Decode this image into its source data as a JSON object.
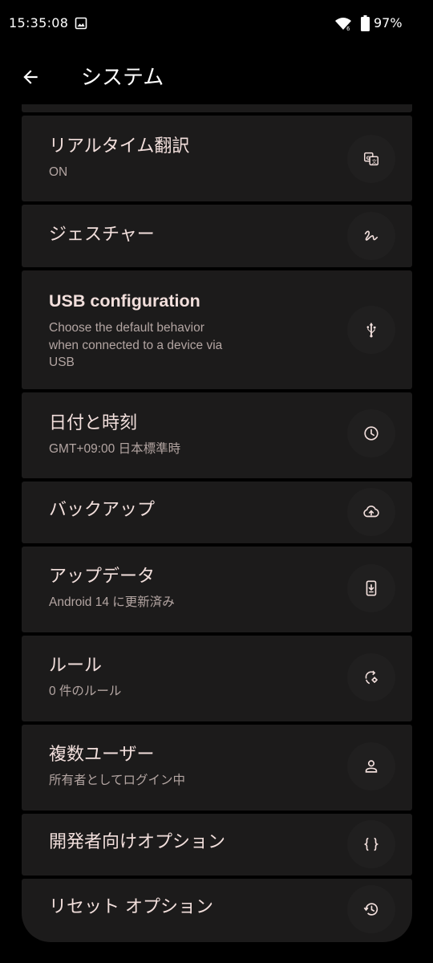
{
  "status_bar": {
    "time": "15:35:08",
    "battery_percent": "97%",
    "icons": [
      "image-icon",
      "wifi-icon",
      "battery-icon"
    ]
  },
  "header": {
    "back_icon": "arrow-back-icon",
    "title": "システム"
  },
  "items": [
    {
      "title": "リアルタイム翻訳",
      "subtitle": "ON",
      "icon": "translate-icon"
    },
    {
      "title": "ジェスチャー",
      "subtitle": "",
      "icon": "gesture-icon"
    },
    {
      "title": "USB configuration",
      "subtitle": "Choose the default behavior\nwhen connected to a device via\nUSB",
      "icon": "usb-icon"
    },
    {
      "title": "日付と時刻",
      "subtitle": "GMT+09:00 日本標準時",
      "icon": "clock-icon"
    },
    {
      "title": "バックアップ",
      "subtitle": "",
      "icon": "cloud-upload-icon"
    },
    {
      "title": "アップデータ",
      "subtitle": "Android 14 に更新済み",
      "icon": "system-update-icon"
    },
    {
      "title": "ルール",
      "subtitle": "0 件のルール",
      "icon": "rules-icon"
    },
    {
      "title": "複数ユーザー",
      "subtitle": "所有者としてログイン中",
      "icon": "person-icon"
    },
    {
      "title": "開発者向けオプション",
      "subtitle": "",
      "icon": "code-braces-icon"
    },
    {
      "title": "リセット オプション",
      "subtitle": "",
      "icon": "history-icon"
    }
  ],
  "colors": {
    "background": "#000000",
    "card": "#1c1b1b",
    "icon_circle": "#201f1f",
    "title_text": "#f2dfdc",
    "subtitle_text": "#b3a5a2"
  }
}
